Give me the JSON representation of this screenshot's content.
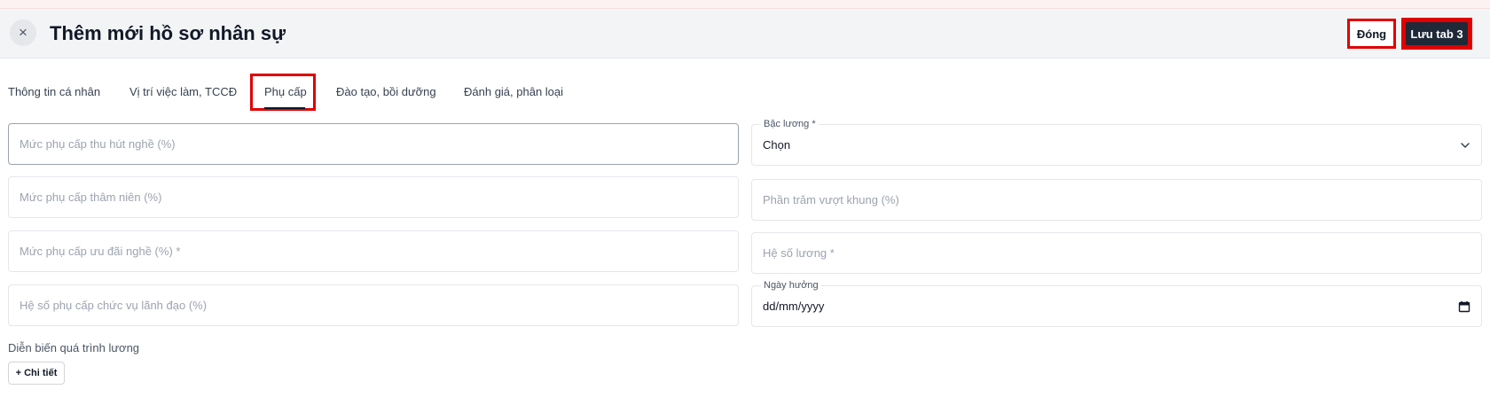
{
  "header": {
    "close_icon": "close-icon",
    "close_glyph": "×",
    "title": "Thêm mới hồ sơ nhân sự",
    "close_label": "Đóng",
    "save_label": "Lưu tab 3"
  },
  "tabs": [
    {
      "label": "Thông tin cá nhân",
      "active": false
    },
    {
      "label": "Vị trí việc làm, TCCĐ",
      "active": false
    },
    {
      "label": "Phụ cấp",
      "active": true
    },
    {
      "label": "Đào tạo, bồi dưỡng",
      "active": false
    },
    {
      "label": "Đánh giá, phân loại",
      "active": false
    }
  ],
  "form": {
    "left": [
      {
        "placeholder": "Mức phụ cấp thu hút nghề (%)"
      },
      {
        "placeholder": "Mức phụ cấp thâm niên (%)"
      },
      {
        "placeholder": "Mức phụ cấp ưu đãi nghề (%) *"
      },
      {
        "placeholder": "Hệ số phụ cấp chức vụ lãnh đạo (%)"
      }
    ],
    "right": {
      "salary_grade": {
        "label": "Bậc lương *",
        "value": "Chọn",
        "icon": "chevron-down-icon"
      },
      "over_frame_percent": {
        "placeholder": "Phần trăm vượt khung (%)"
      },
      "salary_coefficient": {
        "placeholder": "Hệ số lương *"
      },
      "effective_date": {
        "label": "Ngày hưởng",
        "value": "dd/mm/yyyy",
        "icon": "calendar-icon"
      }
    }
  },
  "salary_history": {
    "label": "Diễn biến quá trình lương",
    "detail_button": "+ Chi tiết"
  },
  "colors": {
    "highlight": "#e00000",
    "save_button": "#1f2937",
    "header_bg": "#f3f4f6"
  }
}
